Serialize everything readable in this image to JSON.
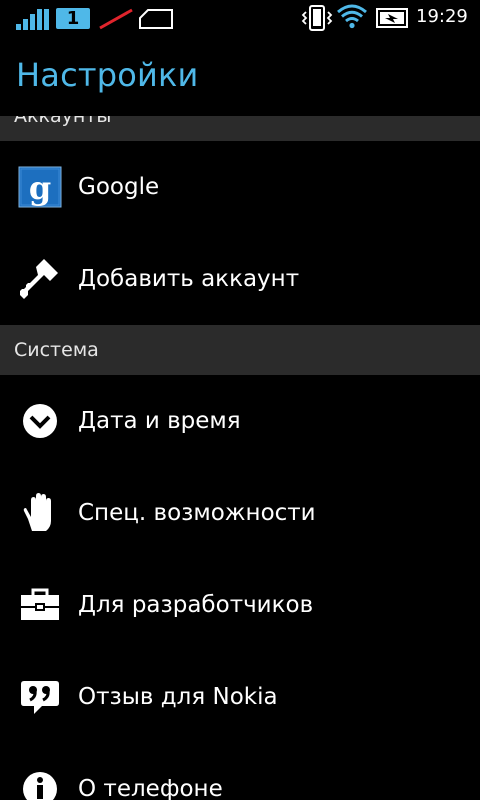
{
  "status_bar": {
    "sim_number": "1",
    "time": "19:29",
    "icons": [
      "signal-icon",
      "sim-icon",
      "no-data-icon",
      "sd-card-icon",
      "vibrate-icon",
      "wifi-icon",
      "battery-charging-icon"
    ]
  },
  "header": {
    "title": "Настройки"
  },
  "sections": {
    "accounts": {
      "label": "Аккаунты",
      "items": [
        {
          "label": "Google",
          "icon": "google-icon"
        },
        {
          "label": "Добавить аккаунт",
          "icon": "key-icon"
        }
      ]
    },
    "system": {
      "label": "Система",
      "items": [
        {
          "label": "Дата и время",
          "icon": "clock-icon"
        },
        {
          "label": "Спец. возможности",
          "icon": "hand-icon"
        },
        {
          "label": "Для разработчиков",
          "icon": "toolbox-icon"
        },
        {
          "label": "Отзыв для Nokia",
          "icon": "quote-bubble-icon"
        },
        {
          "label": "О телефоне",
          "icon": "info-icon"
        }
      ]
    }
  },
  "colors": {
    "accent": "#4fb8e8",
    "background": "#000000",
    "section_header_bg": "#2b2b2b",
    "google_blue": "#1d6fbf",
    "no_data_red": "#e0242c"
  }
}
